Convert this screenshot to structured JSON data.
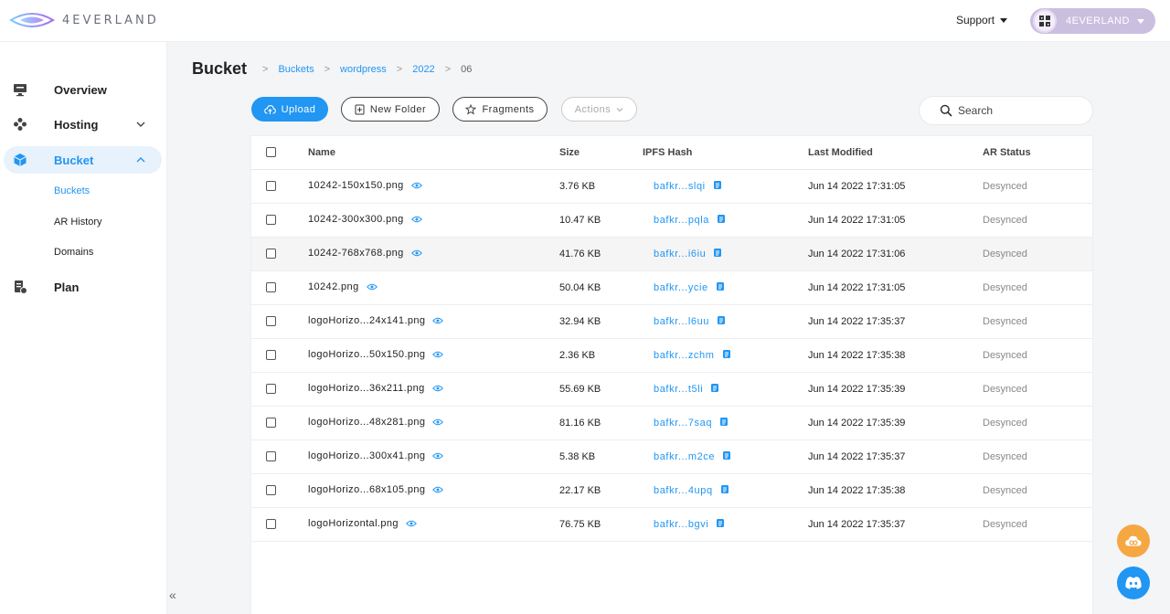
{
  "brand": {
    "name": "4EVERLAND"
  },
  "topbar": {
    "support_label": "Support",
    "user_name": "4EVERLAND"
  },
  "sidebar": {
    "items": [
      {
        "label": "Overview",
        "icon": "monitor-icon"
      },
      {
        "label": "Hosting",
        "icon": "hosting-icon"
      },
      {
        "label": "Bucket",
        "icon": "cube-icon"
      },
      {
        "label": "Plan",
        "icon": "plan-icon"
      }
    ],
    "bucket_subitems": [
      "Buckets",
      "AR History",
      "Domains"
    ]
  },
  "page": {
    "title": "Bucket",
    "breadcrumb": [
      "Buckets",
      "wordpress",
      "2022",
      "06"
    ]
  },
  "toolbar": {
    "upload_label": "Upload",
    "new_folder_label": "New Folder",
    "fragments_label": "Fragments",
    "actions_label": "Actions",
    "search_placeholder": "Search"
  },
  "table": {
    "headers": {
      "name": "Name",
      "size": "Size",
      "hash": "IPFS Hash",
      "modified": "Last Modified",
      "status": "AR Status"
    },
    "rows": [
      {
        "name": "10242-150x150.png",
        "size": "3.76 KB",
        "hash": "bafkr...slqi",
        "modified": "Jun 14 2022 17:31:05",
        "status": "Desynced"
      },
      {
        "name": "10242-300x300.png",
        "size": "10.47 KB",
        "hash": "bafkr...pqla",
        "modified": "Jun 14 2022 17:31:05",
        "status": "Desynced"
      },
      {
        "name": "10242-768x768.png",
        "size": "41.76 KB",
        "hash": "bafkr...i6iu",
        "modified": "Jun 14 2022 17:31:06",
        "status": "Desynced"
      },
      {
        "name": "10242.png",
        "size": "50.04 KB",
        "hash": "bafkr...ycie",
        "modified": "Jun 14 2022 17:31:05",
        "status": "Desynced"
      },
      {
        "name": "logoHorizo...24x141.png",
        "size": "32.94 KB",
        "hash": "bafkr...l6uu",
        "modified": "Jun 14 2022 17:35:37",
        "status": "Desynced"
      },
      {
        "name": "logoHorizo...50x150.png",
        "size": "2.36 KB",
        "hash": "bafkr...zchm",
        "modified": "Jun 14 2022 17:35:38",
        "status": "Desynced"
      },
      {
        "name": "logoHorizo...36x211.png",
        "size": "55.69 KB",
        "hash": "bafkr...t5li",
        "modified": "Jun 14 2022 17:35:39",
        "status": "Desynced"
      },
      {
        "name": "logoHorizo...48x281.png",
        "size": "81.16 KB",
        "hash": "bafkr...7saq",
        "modified": "Jun 14 2022 17:35:39",
        "status": "Desynced"
      },
      {
        "name": "logoHorizo...300x41.png",
        "size": "5.38 KB",
        "hash": "bafkr...m2ce",
        "modified": "Jun 14 2022 17:35:37",
        "status": "Desynced"
      },
      {
        "name": "logoHorizo...68x105.png",
        "size": "22.17 KB",
        "hash": "bafkr...4upq",
        "modified": "Jun 14 2022 17:35:38",
        "status": "Desynced"
      },
      {
        "name": "logoHorizontal.png",
        "size": "76.75 KB",
        "hash": "bafkr...bgvi",
        "modified": "Jun 14 2022 17:35:37",
        "status": "Desynced"
      }
    ]
  },
  "colors": {
    "accent": "#2196f3",
    "sidebar_active_bg": "#e8f2fc",
    "user_pill": "#cbbfe0",
    "fab_orange": "#f5a742"
  }
}
